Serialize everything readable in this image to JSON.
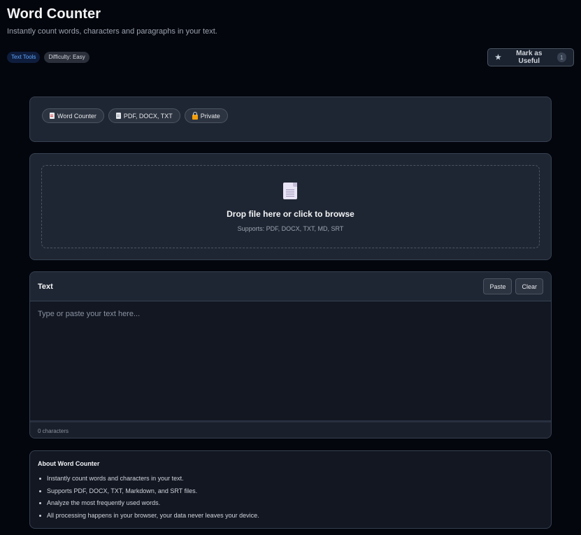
{
  "header": {
    "title": "Word Counter",
    "subtitle": "Instantly count words, characters and paragraphs in your text."
  },
  "tags": {
    "category": "Text Tools",
    "difficulty": "Difficulty: Easy"
  },
  "useful": {
    "label": "Mark as Useful",
    "count": "1",
    "icon": "star-icon"
  },
  "features": {
    "chips": [
      {
        "label": "Word Counter",
        "icon": "document-icon"
      },
      {
        "label": "PDF, DOCX, TXT",
        "icon": "file-icon"
      },
      {
        "label": "Private",
        "icon": "lock-icon"
      }
    ]
  },
  "dropzone": {
    "title": "Drop file here or click to browse",
    "supports": "Supports: PDF, DOCX, TXT, MD, SRT",
    "icon": "file-icon"
  },
  "editor": {
    "label": "Text",
    "paste_label": "Paste",
    "clear_label": "Clear",
    "placeholder": "Type or paste your text here...",
    "value": "",
    "char_count": "0 characters"
  },
  "about": {
    "title": "About Word Counter",
    "items": [
      "Instantly count words and characters in your text.",
      "Supports PDF, DOCX, TXT, Markdown, and SRT files.",
      "Analyze the most frequently used words.",
      "All processing happens in your browser, your data never leaves your device."
    ]
  },
  "colors": {
    "background": "#03060d",
    "card": "#1f2633",
    "accent_blue": "#60a5fa"
  }
}
